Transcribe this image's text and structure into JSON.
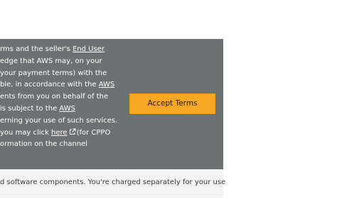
{
  "terms": {
    "line1_text": "rms and the seller's ",
    "line1_link": "End User",
    "line2": "edge that AWS may, on your",
    "line3": "your payment terms) with the",
    "line4_text": "ble, in accordance with the ",
    "line4_link": "AWS",
    "line5": "ents from you on behalf of the",
    "line6_text": "is subject to the ",
    "line6_link": "AWS",
    "line7": "erning your use of such services.",
    "line8_text": "you may click ",
    "line8_link": "here",
    "line8_after": "(for CPPO",
    "line9": "ormation on the channel"
  },
  "accept_button": {
    "label": "Accept Terms"
  },
  "footer": {
    "text": "d software components. You're charged separately for your use"
  },
  "colors": {
    "banner_bg": "#6b7271",
    "accept_button_bg": "#f7a823",
    "footer_bg": "#f3f3f3"
  },
  "icons": {
    "external_link": "external-link-icon"
  }
}
